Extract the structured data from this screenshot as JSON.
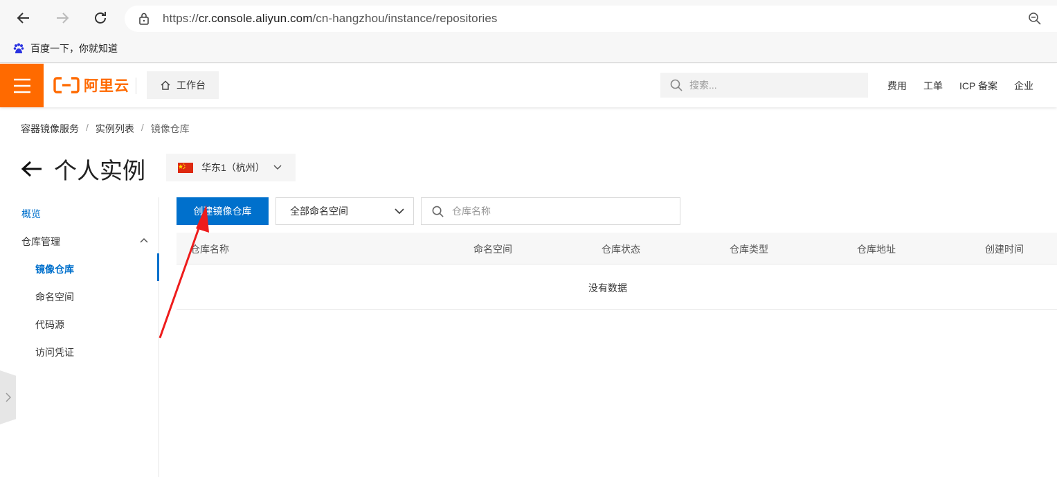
{
  "browser": {
    "url_prefix": "https://",
    "url_host": "cr.console.aliyun.com",
    "url_path": "/cn-hangzhou/instance/repositories",
    "bookmark": "百度一下，你就知道"
  },
  "topnav": {
    "logo_text": "阿里云",
    "workbench": "工作台",
    "search_placeholder": "搜索...",
    "links": [
      "费用",
      "工单",
      "ICP 备案",
      "企业"
    ],
    "brand_color": "#ff6a00"
  },
  "breadcrumb": [
    "容器镜像服务",
    "实例列表",
    "镜像仓库"
  ],
  "page": {
    "title": "个人实例",
    "region": "华东1（杭州）"
  },
  "sidebar": {
    "overview": "概览",
    "repo_management": "仓库管理",
    "items": [
      "镜像仓库",
      "命名空间",
      "代码源",
      "访问凭证"
    ],
    "active_color": "#0070cc"
  },
  "toolbar": {
    "create_button": "创建镜像仓库",
    "namespace_select": "全部命名空间",
    "search_placeholder": "仓库名称"
  },
  "table": {
    "columns": [
      "仓库名称",
      "命名空间",
      "仓库状态",
      "仓库类型",
      "仓库地址",
      "创建时间"
    ],
    "empty_text": "没有数据"
  }
}
